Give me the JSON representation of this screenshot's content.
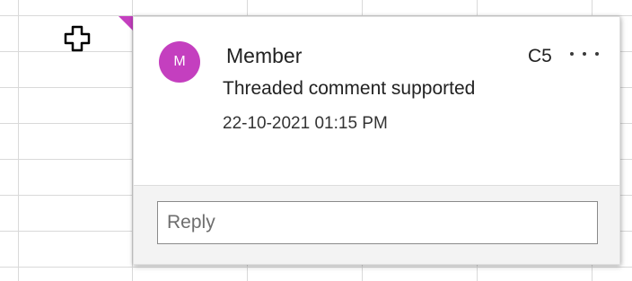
{
  "comment": {
    "avatar_initial": "M",
    "avatar_color": "#c43fbf",
    "author": "Member",
    "cell_ref": "C5",
    "text": "Threaded comment supported",
    "timestamp": "22-10-2021 01:15 PM"
  },
  "reply": {
    "placeholder": "Reply"
  },
  "icons": {
    "cursor": "cell-select-cross-icon",
    "indicator": "comment-indicator-icon",
    "more": "more-options-icon"
  }
}
